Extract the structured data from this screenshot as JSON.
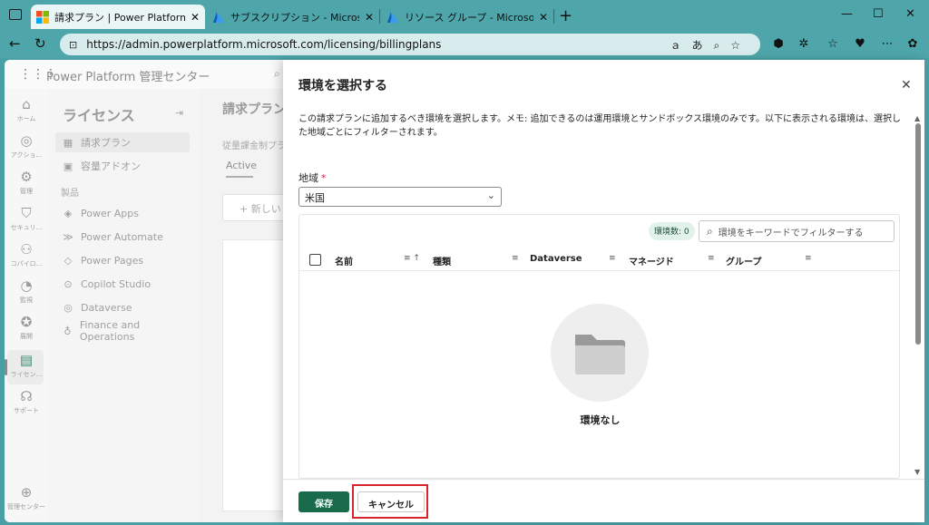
{
  "browser": {
    "tabs": [
      {
        "label": "請求プラン | Power Platform 管理セ",
        "active": true,
        "icon": "ms-logo-icon"
      },
      {
        "label": "サブスクリプション - Microsoft Azure",
        "active": false,
        "icon": "azure-icon"
      },
      {
        "label": "リソース グループ - Microsoft Azure",
        "active": false,
        "icon": "azure-icon"
      }
    ],
    "url": "https://admin.powerplatform.microsoft.com/licensing/billingplans"
  },
  "app": {
    "title": "Power Platform 管理センター"
  },
  "rail": {
    "items": [
      {
        "label": "ホーム",
        "icon": "home-icon",
        "glyph": "⌂"
      },
      {
        "label": "アクショ...",
        "icon": "actions-icon",
        "glyph": "◎"
      },
      {
        "label": "管理",
        "icon": "manage-icon",
        "glyph": "⚙"
      },
      {
        "label": "セキュリ...",
        "icon": "shield-icon",
        "glyph": "⛉"
      },
      {
        "label": "コパイロ...",
        "icon": "copilot-icon",
        "glyph": "⚇"
      },
      {
        "label": "監視",
        "icon": "monitor-icon",
        "glyph": "◔"
      },
      {
        "label": "展開",
        "icon": "deploy-icon",
        "glyph": "✪"
      },
      {
        "label": "ライセン...",
        "icon": "license-icon",
        "glyph": "▤"
      },
      {
        "label": "サポート",
        "icon": "support-icon",
        "glyph": "☊"
      }
    ],
    "bottom": {
      "label": "管理センター",
      "icon": "globe-icon",
      "glyph": "⊕"
    }
  },
  "subnav": {
    "title": "ライセンス",
    "items": [
      {
        "label": "請求プラン",
        "icon": "billing-icon",
        "glyph": "▦",
        "selected": true
      },
      {
        "label": "容量アドオン",
        "icon": "capacity-icon",
        "glyph": "▣",
        "selected": false
      }
    ],
    "section": "製品",
    "products": [
      {
        "label": "Power Apps",
        "icon": "power-apps-icon",
        "glyph": "◈"
      },
      {
        "label": "Power Automate",
        "icon": "power-automate-icon",
        "glyph": "≫"
      },
      {
        "label": "Power Pages",
        "icon": "power-pages-icon",
        "glyph": "◇"
      },
      {
        "label": "Copilot Studio",
        "icon": "copilot-studio-icon",
        "glyph": "⊙"
      },
      {
        "label": "Dataverse",
        "icon": "dataverse-icon",
        "glyph": "◎"
      },
      {
        "label": "Finance and Operations",
        "icon": "finance-icon",
        "glyph": "♁"
      }
    ]
  },
  "content": {
    "title": "請求プラン",
    "subtitle": "従量課金制プラ",
    "tab": "Active",
    "new_button": "新しい"
  },
  "panel": {
    "title": "環境を選択する",
    "description": "この請求プランに追加するべき環境を選択します。メモ: 追加できるのは運用環境とサンドボックス環境のみです。以下に表示される環境は、選択した地域ごとにフィルターされます。",
    "region_label": "地域",
    "region_required": "*",
    "region_value": "米国",
    "env_count": "環境数: 0",
    "filter_placeholder": "環境をキーワードでフィルターする",
    "columns": [
      "名前",
      "種類",
      "Dataverse",
      "マネージド",
      "グループ"
    ],
    "empty_text": "環境なし",
    "save_label": "保存",
    "cancel_label": "キャンセル"
  },
  "colors": {
    "primary": "#196b4b",
    "highlight": "#d9232d",
    "browser_frame": "#4ea6aa"
  }
}
